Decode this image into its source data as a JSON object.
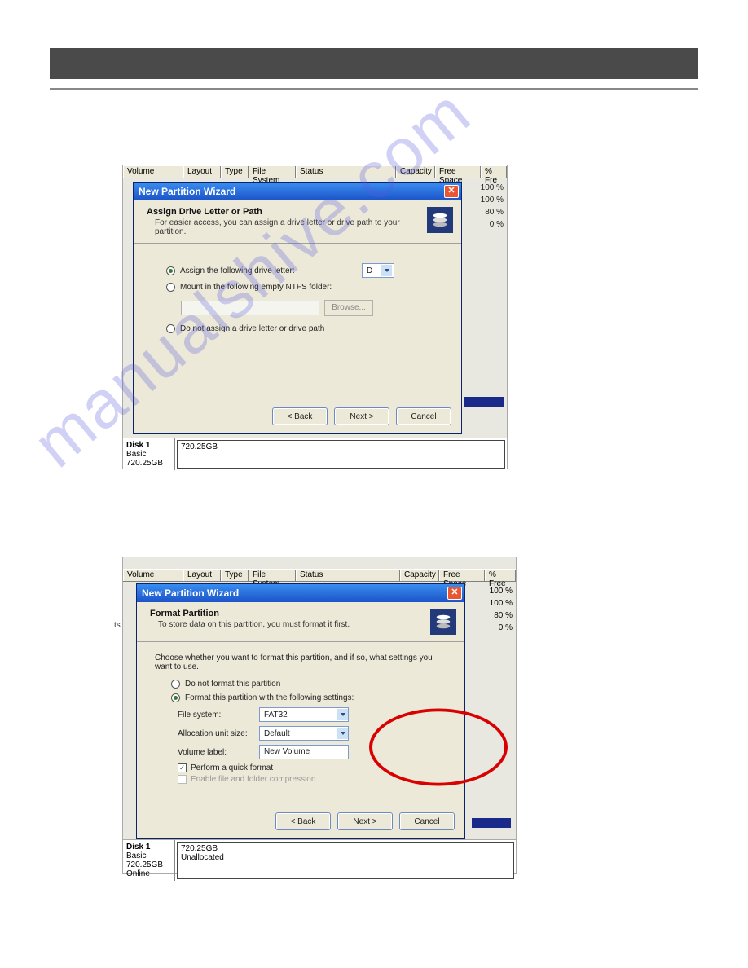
{
  "watermark": "manualshive.com",
  "table": {
    "headers": [
      "Volume",
      "Layout",
      "Type",
      "File System",
      "Status",
      "Capacity",
      "Free Space",
      "% Fre"
    ],
    "headers2": [
      "Volume",
      "Layout",
      "Type",
      "File System",
      "Status",
      "Capacity",
      "Free Space",
      "% Free"
    ]
  },
  "side_percent": {
    "v1": "100 %",
    "v2": "100 %",
    "v3": "80 %",
    "v4": "0 %"
  },
  "dialog1": {
    "title": "New Partition Wizard",
    "hdr_title": "Assign Drive Letter or Path",
    "hdr_sub": "For easier access, you can assign a drive letter or drive path to your partition.",
    "opt_assign": "Assign the following drive letter:",
    "drive_value": "D",
    "opt_mount": "Mount in the following empty NTFS folder:",
    "browse": "Browse...",
    "opt_none": "Do not assign a drive letter or drive path",
    "btn_back": "< Back",
    "btn_next": "Next >",
    "btn_cancel": "Cancel"
  },
  "disk1": {
    "name": "Disk 1",
    "type": "Basic",
    "size": "720.25GB",
    "block_size": "720.25GB"
  },
  "dialog2": {
    "title": "New Partition Wizard",
    "hdr_title": "Format Partition",
    "hdr_sub": "To store data on this partition, you must format it first.",
    "instruct": "Choose whether you want to format this partition, and if so, what settings you want to use.",
    "opt_noformat": "Do not format this partition",
    "opt_format": "Format this partition with the following settings:",
    "label_fs": "File system:",
    "fs_value": "FAT32",
    "label_alloc": "Allocation unit size:",
    "alloc_value": "Default",
    "label_vol": "Volume label:",
    "vol_value": "New Volume",
    "quick_format": "Perform a quick format",
    "compression": "Enable file and folder compression",
    "btn_back": "< Back",
    "btn_next": "Next >",
    "btn_cancel": "Cancel"
  },
  "disk2": {
    "name": "Disk 1",
    "type": "Basic",
    "size": "720.25GB",
    "status": "Online",
    "block_size": "720.25GB",
    "block_status": "Unallocated"
  },
  "ts_label": "ts"
}
